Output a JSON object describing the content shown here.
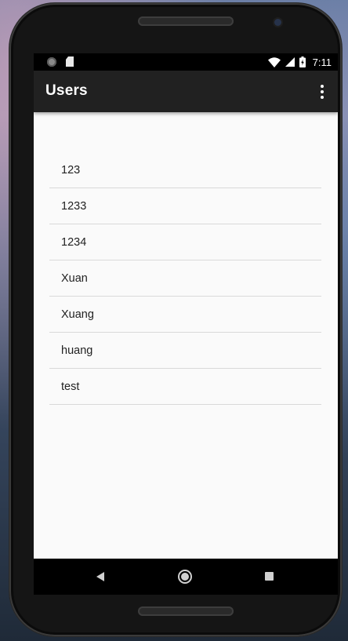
{
  "status_bar": {
    "time": "7:11",
    "icons": [
      "circle-notification-icon",
      "sd-card-icon",
      "wifi-icon",
      "cell-signal-icon",
      "battery-charging-icon"
    ]
  },
  "toolbar": {
    "title": "Users",
    "menu_icon": "more-vert-icon"
  },
  "users": [
    "123",
    "1233",
    "1234",
    "Xuan",
    "Xuang",
    "huang",
    "test"
  ],
  "nav_bar": {
    "icons": [
      "back-icon",
      "home-icon",
      "recents-icon"
    ]
  },
  "colors": {
    "toolbar": "#212121",
    "content_background": "#fafafa",
    "divider": "#d9d9d9"
  }
}
